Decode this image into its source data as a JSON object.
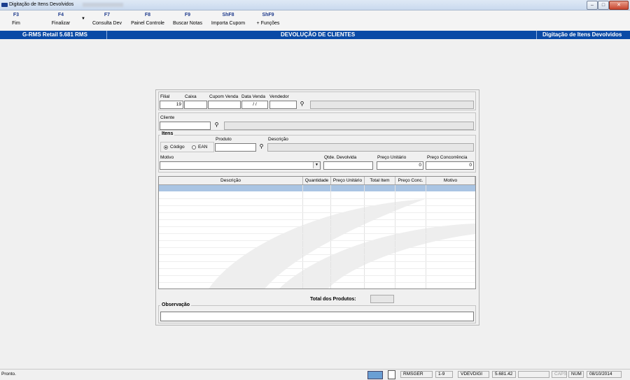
{
  "window": {
    "title": "Digitação de Itens Devolvidos",
    "controls": [
      "–",
      "□",
      "✕"
    ]
  },
  "toolbar": [
    {
      "key": "F3",
      "label": "Fim"
    },
    {
      "key": "F4",
      "label": "Finalizar"
    },
    {
      "key": "F7",
      "label": "Consulta Dev"
    },
    {
      "key": "F8",
      "label": "Painel Controle"
    },
    {
      "key": "F9",
      "label": "Buscar Notas"
    },
    {
      "key": "ShF8",
      "label": "Importa Cupom"
    },
    {
      "key": "ShF9",
      "label": "+ Funções"
    }
  ],
  "header_bar": {
    "left": "G-RMS Retail 5.681 RMS",
    "center": "DEVOLUÇÃO DE CLIENTES",
    "right": "Digitação de Itens Devolvidos"
  },
  "form": {
    "filial": {
      "label": "Filial",
      "value": "19"
    },
    "caixa": {
      "label": "Caixa",
      "value": ""
    },
    "cupom_venda": {
      "label": "Cupom Venda",
      "value": ""
    },
    "data_venda": {
      "label": "Data Venda",
      "value": "/ /"
    },
    "vendedor": {
      "label": "Vendedor",
      "value": ""
    },
    "cliente": {
      "label": "Cliente",
      "value": ""
    },
    "itens": {
      "legend": "Itens",
      "codigo_option": "Código",
      "ean_option": "EAN",
      "produto_label": "Produto",
      "descricao_label": "Descrição"
    },
    "motivo": {
      "label": "Motivo",
      "value": ""
    },
    "qtde_devolvida": {
      "label": "Qtde. Devolvida",
      "value": ""
    },
    "preco_unitario": {
      "label": "Preço Unitário",
      "value": "0"
    },
    "preco_concorrencia": {
      "label": "Preço Concorrência",
      "value": "0"
    },
    "grid_columns": [
      "Descrição",
      "Quantidade",
      "Preço Unitário",
      "Total Item",
      "Preço Conc.",
      "Motivo"
    ],
    "total_produtos_label": "Total dos Produtos:",
    "total_produtos_value": "",
    "observacao": {
      "legend": "Observação",
      "value": ""
    }
  },
  "statusbar": {
    "message": "Pronto.",
    "user": "RMSGER",
    "code": "1-9",
    "program": "VDEVDIGI",
    "version": "5.681.42",
    "caps": "CAPS",
    "num": "NUM",
    "date": "08/10/2014"
  }
}
